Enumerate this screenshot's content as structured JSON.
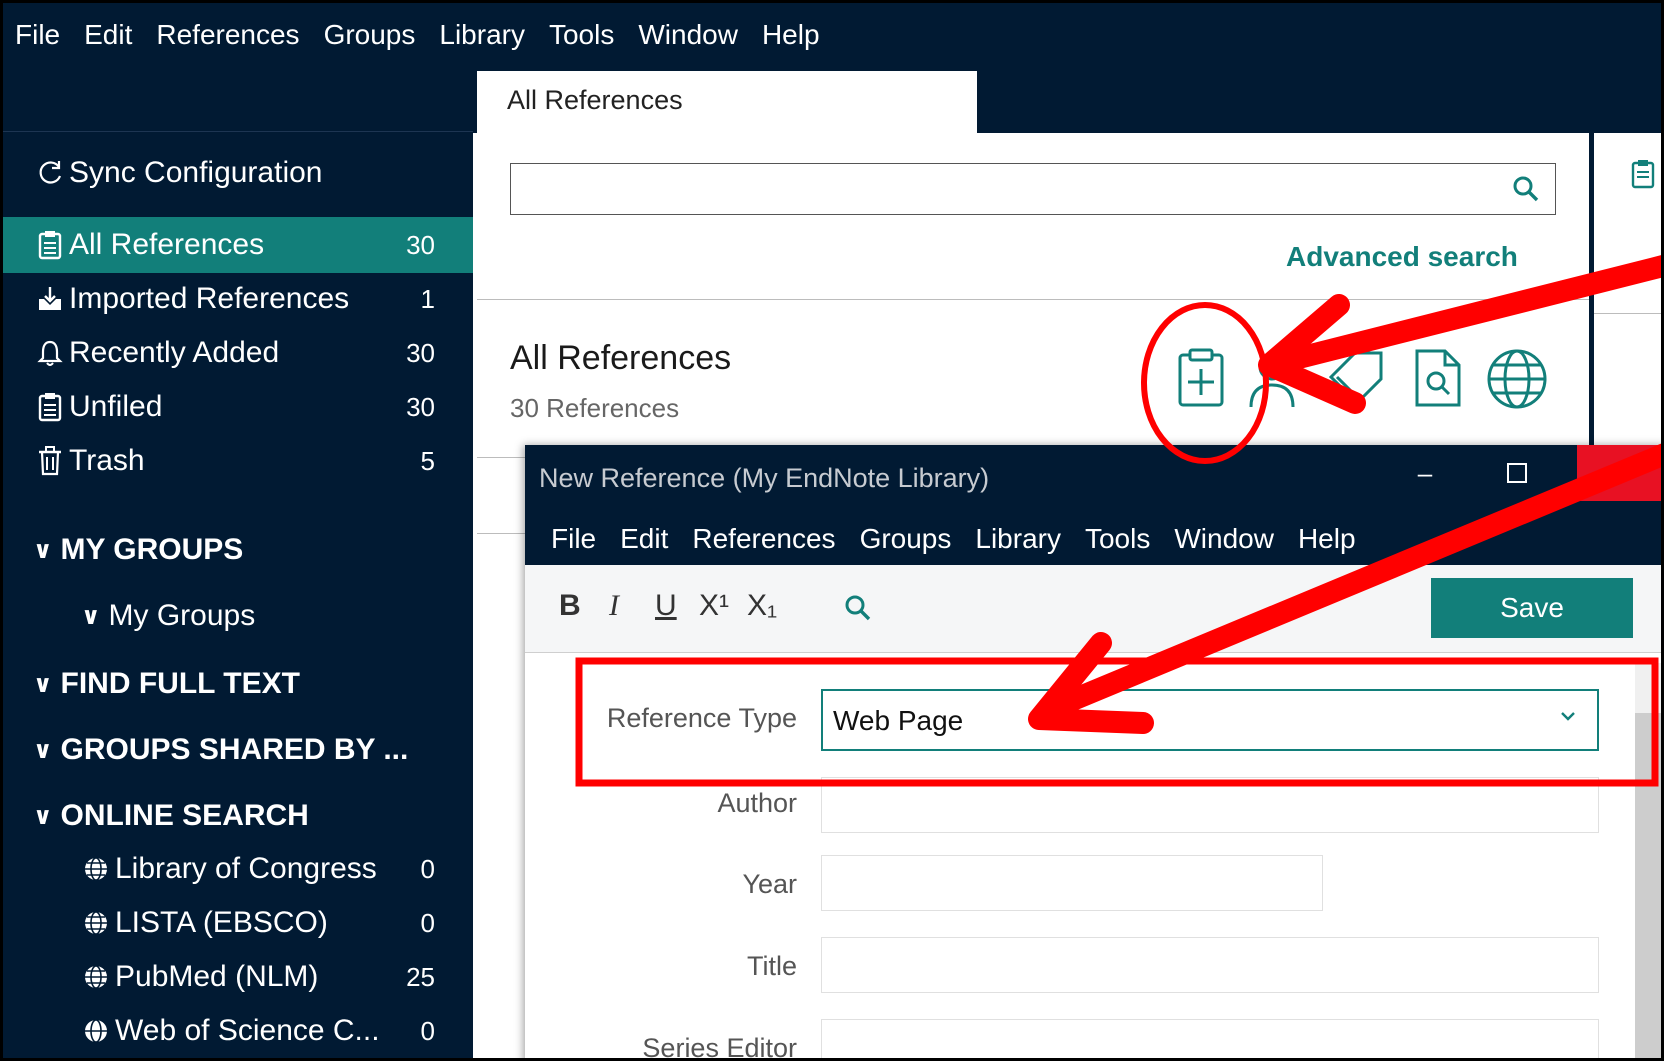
{
  "menu": [
    "File",
    "Edit",
    "References",
    "Groups",
    "Library",
    "Tools",
    "Window",
    "Help"
  ],
  "sidebar": {
    "sync": "Sync Configuration",
    "items": [
      {
        "label": "All References",
        "count": "30"
      },
      {
        "label": "Imported References",
        "count": "1"
      },
      {
        "label": "Recently Added",
        "count": "30"
      },
      {
        "label": "Unfiled",
        "count": "30"
      },
      {
        "label": "Trash",
        "count": "5"
      }
    ],
    "my_groups": "MY GROUPS",
    "my_groups_sub": "My Groups",
    "find_full_text": "FIND FULL TEXT",
    "groups_shared": "GROUPS SHARED BY ...",
    "online_search": "ONLINE SEARCH",
    "online": [
      {
        "label": "Library of Congress",
        "count": "0"
      },
      {
        "label": "LISTA (EBSCO)",
        "count": "0"
      },
      {
        "label": "PubMed (NLM)",
        "count": "25"
      },
      {
        "label": "Web of Science C...",
        "count": "0"
      }
    ]
  },
  "tab": "All References",
  "search": {
    "placeholder": "",
    "advanced": "Advanced search"
  },
  "list": {
    "title": "All References",
    "count": "30 References"
  },
  "dialog": {
    "title": "New Reference (My EndNote Library)",
    "menu": [
      "File",
      "Edit",
      "References",
      "Groups",
      "Library",
      "Tools",
      "Window",
      "Help"
    ],
    "format": {
      "bold": "B",
      "italic": "I",
      "underline": "U",
      "superscript": "X¹",
      "subscript": "X₁"
    },
    "save": "Save",
    "fields": {
      "reference_type_label": "Reference Type",
      "reference_type_value": "Web Page",
      "author": "Author",
      "year": "Year",
      "title": "Title",
      "series_editor": "Series Editor"
    }
  },
  "colors": {
    "navy": "#011a33",
    "teal": "#127f7a",
    "annotation_red": "#ff0000"
  }
}
